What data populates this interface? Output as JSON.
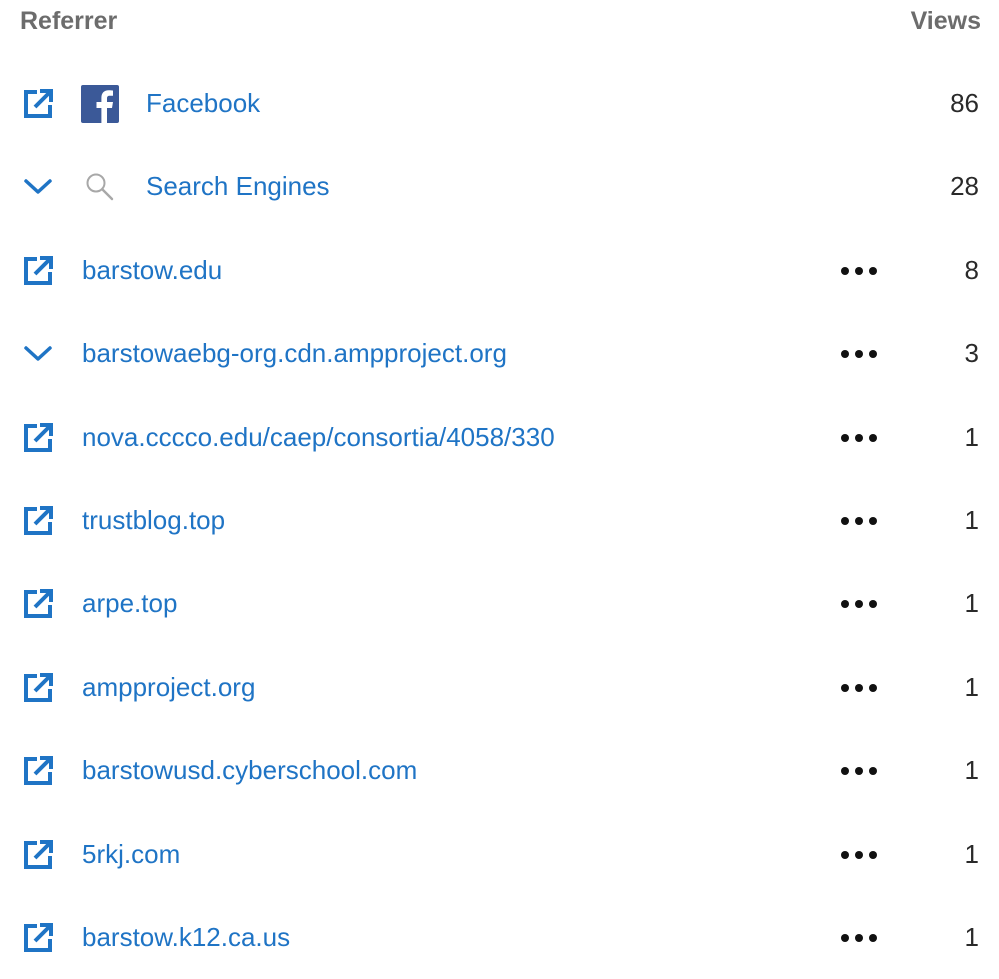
{
  "header": {
    "referrer_label": "Referrer",
    "views_label": "Views"
  },
  "colors": {
    "link": "#1f74c5",
    "header_text": "#6c6c6c",
    "facebook_blue": "#3b5998"
  },
  "rows": [
    {
      "label": "Facebook",
      "views": "86",
      "lead_icon": "external-link-icon",
      "brand_icon": "facebook-icon",
      "has_more": false
    },
    {
      "label": "Search Engines",
      "views": "28",
      "lead_icon": "chevron-down-icon",
      "brand_icon": "search-icon",
      "has_more": false
    },
    {
      "label": "barstow.edu",
      "views": "8",
      "lead_icon": "external-link-icon",
      "has_more": true
    },
    {
      "label": "barstowaebg-org.cdn.ampproject.org",
      "views": "3",
      "lead_icon": "chevron-down-icon",
      "has_more": true
    },
    {
      "label": "nova.cccco.edu/caep/consortia/4058/330",
      "views": "1",
      "lead_icon": "external-link-icon",
      "has_more": true
    },
    {
      "label": "trustblog.top",
      "views": "1",
      "lead_icon": "external-link-icon",
      "has_more": true
    },
    {
      "label": "arpe.top",
      "views": "1",
      "lead_icon": "external-link-icon",
      "has_more": true
    },
    {
      "label": "ampproject.org",
      "views": "1",
      "lead_icon": "external-link-icon",
      "has_more": true
    },
    {
      "label": "barstowusd.cyberschool.com",
      "views": "1",
      "lead_icon": "external-link-icon",
      "has_more": true
    },
    {
      "label": "5rkj.com",
      "views": "1",
      "lead_icon": "external-link-icon",
      "has_more": true
    },
    {
      "label": "barstow.k12.ca.us",
      "views": "1",
      "lead_icon": "external-link-icon",
      "has_more": true
    }
  ]
}
